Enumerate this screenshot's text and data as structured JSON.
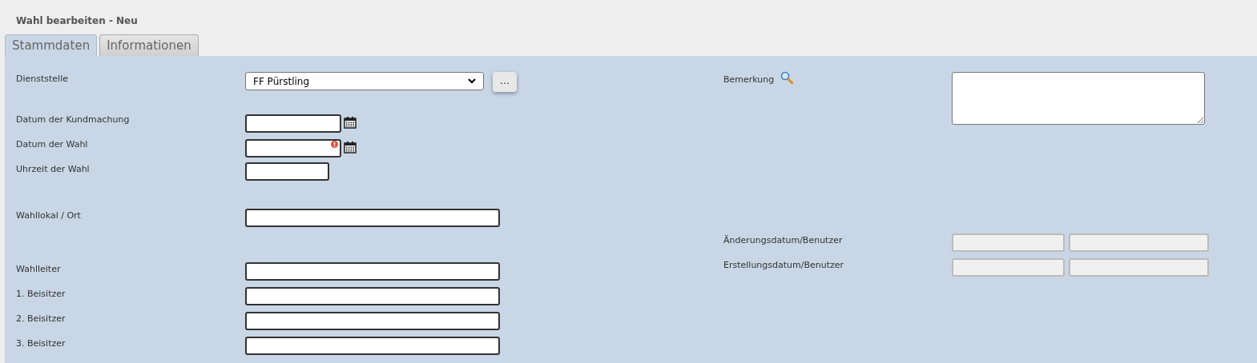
{
  "title": "Wahl bearbeiten - Neu",
  "tabs": [
    {
      "label": "Stammdaten",
      "selected": true
    },
    {
      "label": "Informationen",
      "selected": false
    }
  ],
  "left_groups": [
    [
      {
        "label": "Dienststelle",
        "kind": "select",
        "value": "FF Pürstling",
        "button": "..."
      }
    ],
    [
      {
        "label": "Datum der Kundmachung",
        "kind": "date",
        "error": false
      },
      {
        "label": "Datum der Wahl",
        "kind": "date",
        "error": true
      },
      {
        "label": "Uhrzeit der Wahl",
        "kind": "short"
      }
    ],
    [
      {
        "label": "Wahllokal / Ort",
        "kind": "text"
      }
    ],
    [
      {
        "label": "Wahlleiter",
        "kind": "text"
      },
      {
        "label": "1. Beisitzer",
        "kind": "text"
      },
      {
        "label": "2. Beisitzer",
        "kind": "text"
      },
      {
        "label": "3. Beisitzer",
        "kind": "text"
      }
    ]
  ],
  "remark": {
    "label": "Bemerkung"
  },
  "audit_rows": [
    {
      "label": "Änderungsdatum/Benutzer"
    },
    {
      "label": "Erstellungsdatum/Benutzer"
    }
  ]
}
